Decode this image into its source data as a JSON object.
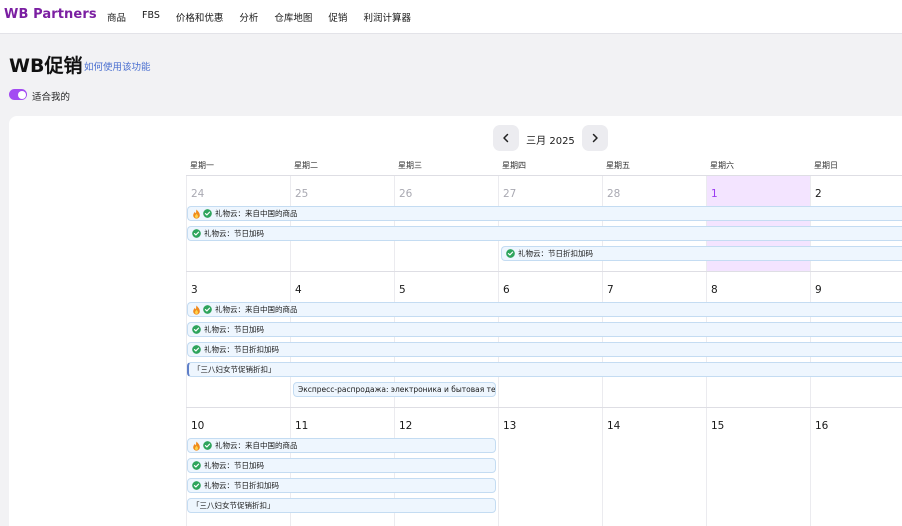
{
  "app": {
    "logo": "WB Partners",
    "nav": [
      "商品",
      "FBS",
      "价格和优惠",
      "分析",
      "仓库地图",
      "促销",
      "利润计算器"
    ]
  },
  "page": {
    "title": "WB促销",
    "help_link": "如何使用该功能",
    "toggle_label": "适合我的"
  },
  "calendar": {
    "month_label": "三月 2025",
    "weekdays": [
      "星期一",
      "星期二",
      "星期三",
      "星期四",
      "星期五",
      "星期六",
      "星期日"
    ],
    "weeks": [
      {
        "days": [
          {
            "n": "24",
            "state": "muted"
          },
          {
            "n": "25",
            "state": "muted"
          },
          {
            "n": "26",
            "state": "muted"
          },
          {
            "n": "27",
            "state": "muted"
          },
          {
            "n": "28",
            "state": "muted"
          },
          {
            "n": "1",
            "state": "today"
          },
          {
            "n": "2",
            "state": "normal"
          }
        ]
      },
      {
        "days": [
          {
            "n": "3",
            "state": "normal"
          },
          {
            "n": "4",
            "state": "normal"
          },
          {
            "n": "5",
            "state": "normal"
          },
          {
            "n": "6",
            "state": "normal"
          },
          {
            "n": "7",
            "state": "normal"
          },
          {
            "n": "8",
            "state": "normal"
          },
          {
            "n": "9",
            "state": "normal"
          }
        ]
      },
      {
        "days": [
          {
            "n": "10",
            "state": "normal"
          },
          {
            "n": "11",
            "state": "normal"
          },
          {
            "n": "12",
            "state": "normal"
          },
          {
            "n": "13",
            "state": "normal"
          },
          {
            "n": "14",
            "state": "normal"
          },
          {
            "n": "15",
            "state": "normal"
          },
          {
            "n": "16",
            "state": "normal"
          }
        ]
      }
    ],
    "events": [
      {
        "week": 0,
        "lane": 0,
        "start": 0,
        "end": 7,
        "text": "礼物云：来自中国的商品",
        "fire": true,
        "check": true,
        "cont": true,
        "bracket": false
      },
      {
        "week": 0,
        "lane": 1,
        "start": 0,
        "end": 7,
        "text": "礼物云：节日加码",
        "fire": false,
        "check": true,
        "cont": true,
        "bracket": false
      },
      {
        "week": 0,
        "lane": 2,
        "start": 3,
        "end": 7,
        "text": "礼物云：节日折扣加码",
        "fire": false,
        "check": true,
        "cont": true,
        "bracket": false
      },
      {
        "week": 1,
        "lane": 0,
        "start": 0,
        "end": 7,
        "text": "礼物云：来自中国的商品",
        "fire": true,
        "check": true,
        "cont": true,
        "bracket": false
      },
      {
        "week": 1,
        "lane": 1,
        "start": 0,
        "end": 7,
        "text": "礼物云：节日加码",
        "fire": false,
        "check": true,
        "cont": true,
        "bracket": false
      },
      {
        "week": 1,
        "lane": 2,
        "start": 0,
        "end": 7,
        "text": "礼物云：节日折扣加码",
        "fire": false,
        "check": true,
        "cont": true,
        "bracket": false
      },
      {
        "week": 1,
        "lane": 3,
        "start": 0,
        "end": 7,
        "text": "「三八妇女节促销折扣」",
        "fire": false,
        "check": false,
        "cont": true,
        "bracket": true
      },
      {
        "week": 1,
        "lane": 4,
        "start": 1,
        "end": 3,
        "text": "Экспресс-распродажа: электроника и бытовая те...",
        "fire": false,
        "check": false,
        "cont": false,
        "bracket": false
      },
      {
        "week": 2,
        "lane": 0,
        "start": 0,
        "end": 3,
        "text": "礼物云：来自中国的商品",
        "fire": true,
        "check": true,
        "cont": false,
        "bracket": false
      },
      {
        "week": 2,
        "lane": 1,
        "start": 0,
        "end": 3,
        "text": "礼物云：节日加码",
        "fire": false,
        "check": true,
        "cont": false,
        "bracket": false
      },
      {
        "week": 2,
        "lane": 2,
        "start": 0,
        "end": 3,
        "text": "礼物云：节日折扣加码",
        "fire": false,
        "check": true,
        "cont": false,
        "bracket": false
      },
      {
        "week": 2,
        "lane": 3,
        "start": 0,
        "end": 3,
        "text": "「三八妇女节促销折扣」",
        "fire": false,
        "check": false,
        "cont": false,
        "bracket": false
      }
    ]
  },
  "icons": {
    "prev": "chevron-left-icon",
    "next": "chevron-right-icon",
    "fire": "fire-icon",
    "check": "check-circle-icon"
  },
  "colors": {
    "brand": "#7b1fa2",
    "accent": "#a34bf2",
    "today_bg": "#f3e4ff",
    "event_bg": "#eef6fe",
    "check_green": "#2ea45c"
  }
}
